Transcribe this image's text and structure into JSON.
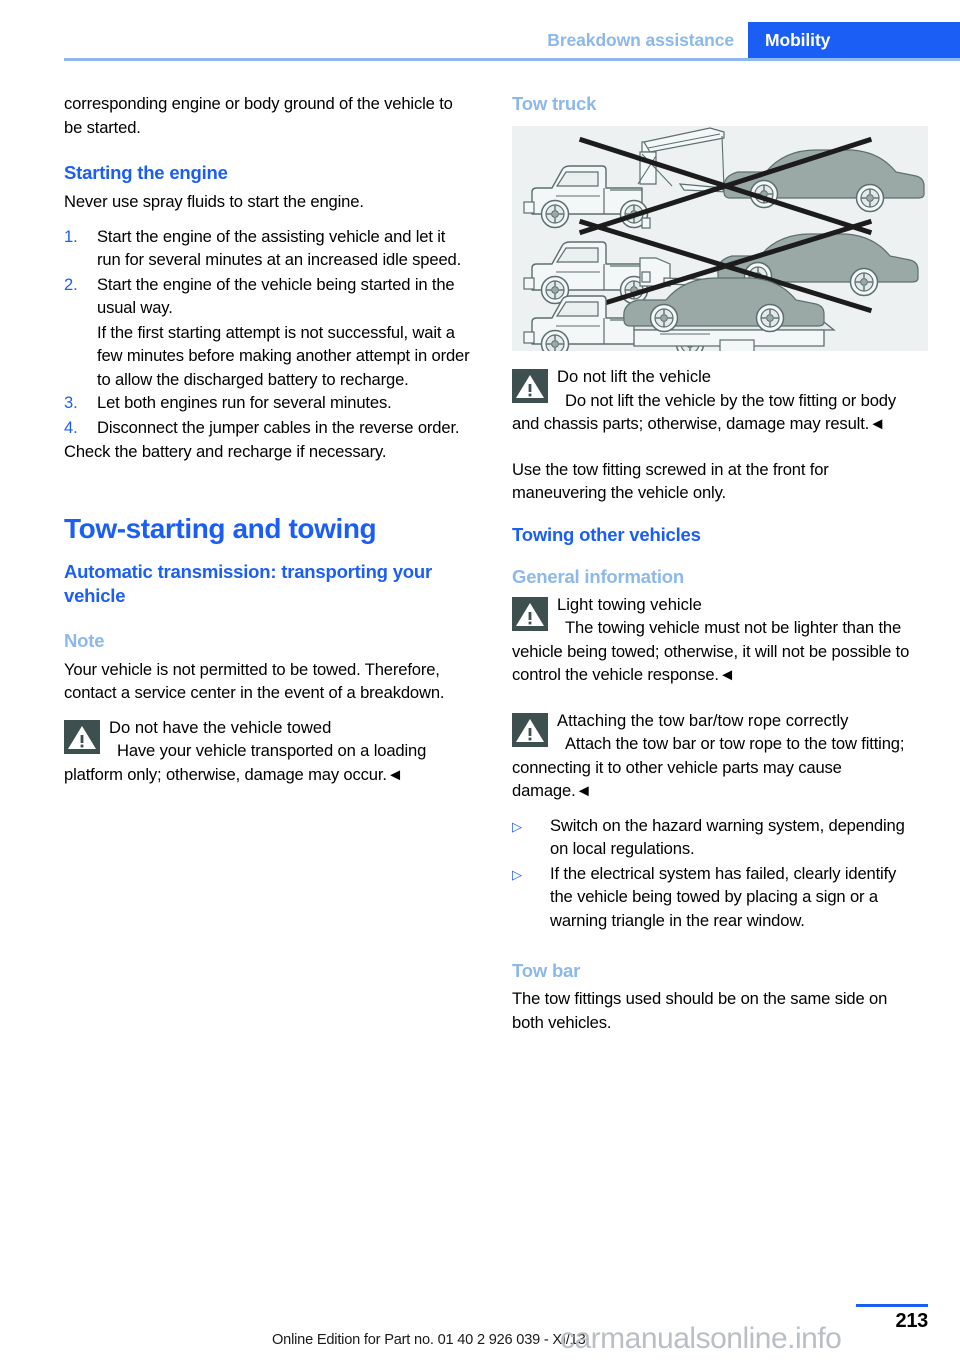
{
  "header": {
    "chapter": "Breakdown assistance",
    "section": "Mobility"
  },
  "left_column": {
    "intro_continuation": "corresponding engine or body ground of the vehicle to be started.",
    "starting_engine": {
      "title": "Starting the engine",
      "lead": "Never use spray fluids to start the engine.",
      "steps": [
        {
          "num": "1.",
          "text": "Start the engine of the assisting vehicle and let it run for several minutes at an increased idle speed."
        },
        {
          "num": "2.",
          "text": "Start the engine of the vehicle being started in the usual way."
        },
        {
          "num": "3.",
          "text": "Let both engines run for several minutes."
        },
        {
          "num": "4.",
          "text": "Disconnect the jumper cables in the reverse order."
        }
      ],
      "step2_continuation": "If the first starting attempt is not successful, wait a few minutes before making another attempt in order to allow the discharged battery to recharge.",
      "closing": "Check the battery and recharge if necessary."
    },
    "tow_starting": {
      "chapter_title": "Tow-starting and towing",
      "section_title": "Automatic transmission: transporting your vehicle",
      "note_title": "Note",
      "note_body": "Your vehicle is not permitted to be towed. Therefore, contact a service center in the event of a breakdown.",
      "warning": {
        "title": "Do not have the vehicle towed",
        "body": "Have your vehicle transported on a loading platform only; otherwise, damage may occur.",
        "end_mark": "◄"
      }
    }
  },
  "right_column": {
    "tow_truck": {
      "title": "Tow truck",
      "figure_alt": "tow-truck-illustration",
      "figure_background": "#edf1f2",
      "figure_rows": [
        "wheel-lift tow truck towing car by front wheels - crossed out",
        "wheel-lift tow truck towing car by rear wheels - crossed out",
        "flatbed tow truck carrying car - permitted"
      ],
      "warning": {
        "title": "Do not lift the vehicle",
        "body": "Do not lift the vehicle by the tow fitting or body and chassis parts; otherwise, damage may result.",
        "end_mark": "◄"
      },
      "after_warning": "Use the tow fitting screwed in at the front for maneuvering the vehicle only."
    },
    "towing_other_vehicles": {
      "section_title": "Towing other vehicles",
      "general_title": "General information",
      "warning_light": {
        "title": "Light towing vehicle",
        "body": "The towing vehicle must not be lighter than the vehicle being towed; otherwise, it will not be possible to control the vehicle response.",
        "end_mark": "◄"
      },
      "warning_attach": {
        "title": "Attaching the tow bar/tow rope correctly",
        "body": "Attach the tow bar or tow rope to the tow fitting; connecting it to other vehicle parts may cause damage.",
        "end_mark": "◄"
      },
      "bullets": [
        "Switch on the hazard warning system, depending on local regulations.",
        "If the electrical system has failed, clearly identify the vehicle being towed by placing a sign or a warning triangle in the rear window."
      ],
      "tow_bar_title": "Tow bar",
      "tow_bar_body": "The tow fittings used should be on the same side on both vehicles."
    }
  },
  "footer": {
    "edition": "Online Edition for Part no. 01 40 2 926 039 - XI/13",
    "page_number": "213",
    "watermark": "carmanualsonline.info"
  },
  "colors": {
    "accent_blue": "#1b5ef5",
    "light_blue": "#8cb8ec",
    "warning_icon_bg": "#3d4f4f",
    "figure_bg": "#edf1f2",
    "vehicle_fill": "#9aa9a5"
  }
}
